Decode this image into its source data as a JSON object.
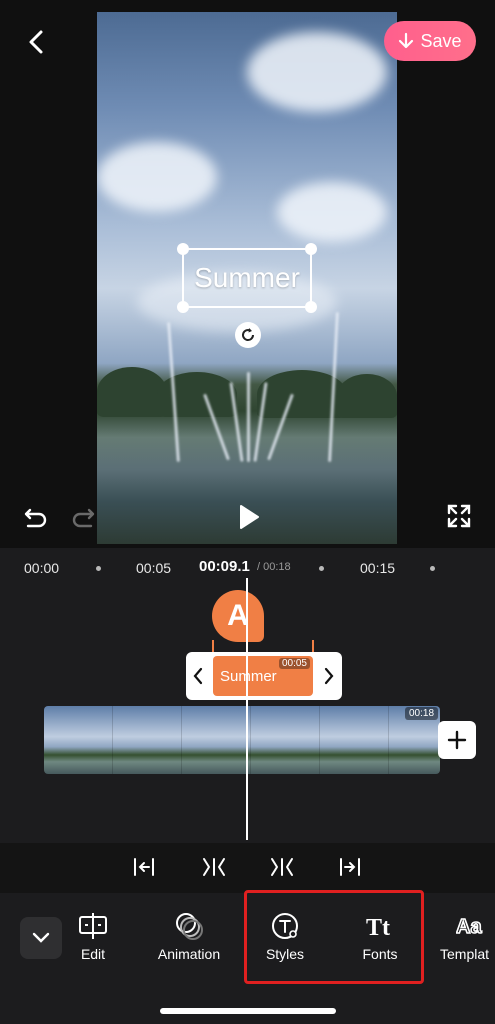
{
  "header": {
    "save_label": "Save"
  },
  "overlay_text": {
    "value": "Summer"
  },
  "ruler": {
    "ticks": [
      "00:00",
      "00:05",
      "00:15"
    ],
    "current_time": "00:09.1",
    "total_time": "/ 00:18"
  },
  "text_track": {
    "marker_letter": "A",
    "clip_label": "Summer",
    "clip_duration": "00:05"
  },
  "video_track": {
    "duration": "00:18"
  },
  "tools": [
    {
      "label": "Edit",
      "icon": "edit-icon"
    },
    {
      "label": "Animation",
      "icon": "animation-icon"
    },
    {
      "label": "Styles",
      "icon": "styles-icon"
    },
    {
      "label": "Fonts",
      "icon": "fonts-icon"
    },
    {
      "label": "Templat",
      "icon": "templates-icon"
    }
  ],
  "colors": {
    "save_gradient_start": "#ff5f8d",
    "text_clip": "#f07f45",
    "highlight": "#e02020"
  }
}
